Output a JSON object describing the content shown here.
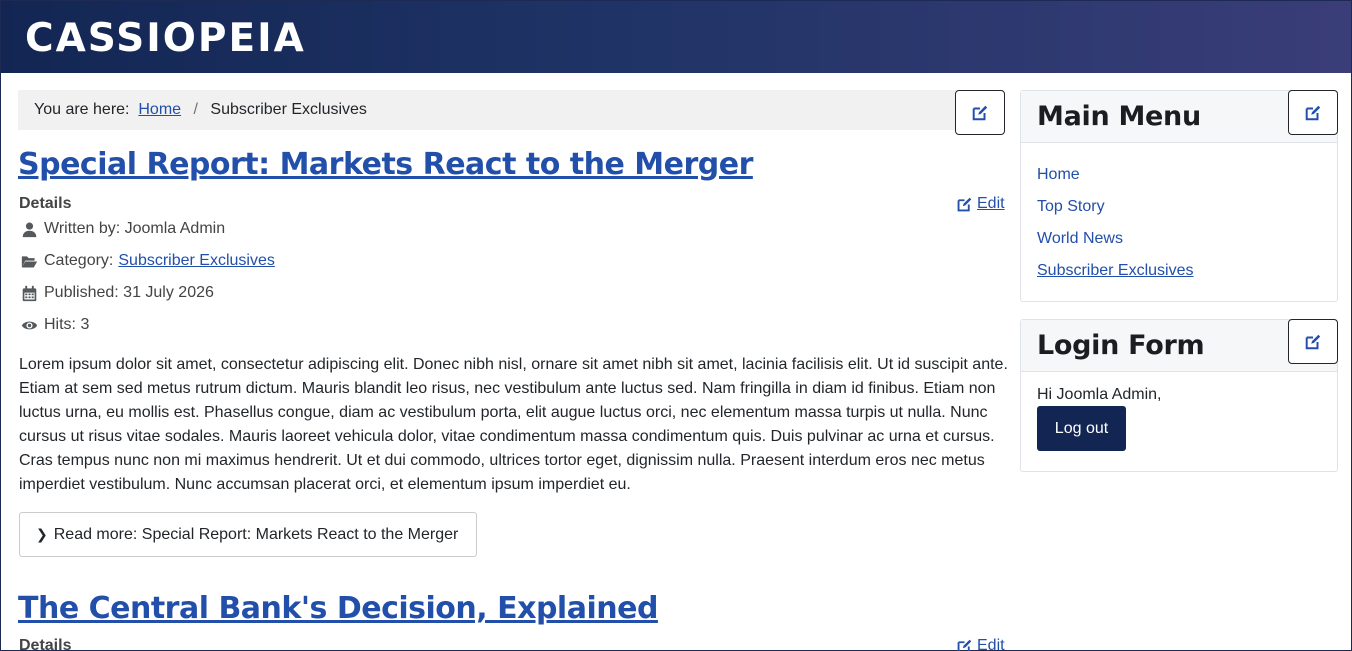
{
  "header": {
    "brand": "CASSIOPEIA"
  },
  "breadcrumb": {
    "prefix": "You are here:",
    "home": "Home",
    "separator": "/",
    "current": "Subscriber Exclusives"
  },
  "articles": [
    {
      "title": "Special Report: Markets React to the Merger",
      "details_label": "Details",
      "edit_label": "Edit",
      "author": "Written by: Joomla Admin",
      "category_prefix": "Category:",
      "category": "Subscriber Exclusives",
      "published": "Published: 31 July 2026",
      "hits": "Hits: 3",
      "body": "Lorem ipsum dolor sit amet, consectetur adipiscing elit. Donec nibh nisl, ornare sit amet nibh sit amet, lacinia facilisis elit. Ut id suscipit ante. Etiam at sem sed metus rutrum dictum. Mauris blandit leo risus, nec vestibulum ante luctus sed. Nam fringilla in diam id finibus. Etiam non luctus urna, eu mollis est. Phasellus congue, diam ac vestibulum porta, elit augue luctus orci, nec elementum massa turpis ut nulla. Nunc cursus ut risus vitae sodales. Mauris laoreet vehicula dolor, vitae condimentum massa condimentum quis. Duis pulvinar ac urna et cursus. Cras tempus nunc non mi maximus hendrerit. Ut et dui commodo, ultrices tortor eget, dignissim nulla. Praesent interdum eros nec metus imperdiet vestibulum. Nunc accumsan placerat orci, et elementum ipsum imperdiet eu.",
      "read_more": "Read more: Special Report: Markets React to the Merger"
    },
    {
      "title": "The Central Bank's Decision, Explained",
      "details_label": "Details",
      "edit_label": "Edit"
    }
  ],
  "sidebar": {
    "main_menu": {
      "title": "Main Menu",
      "items": [
        {
          "label": "Home"
        },
        {
          "label": "Top Story"
        },
        {
          "label": "World News"
        },
        {
          "label": "Subscriber Exclusives"
        }
      ]
    },
    "login": {
      "title": "Login Form",
      "greeting": "Hi Joomla Admin,",
      "logout_label": "Log out"
    }
  },
  "colors": {
    "header_start": "#132653",
    "header_end": "#3a3d78",
    "link": "#224faa",
    "button": "#132653"
  }
}
